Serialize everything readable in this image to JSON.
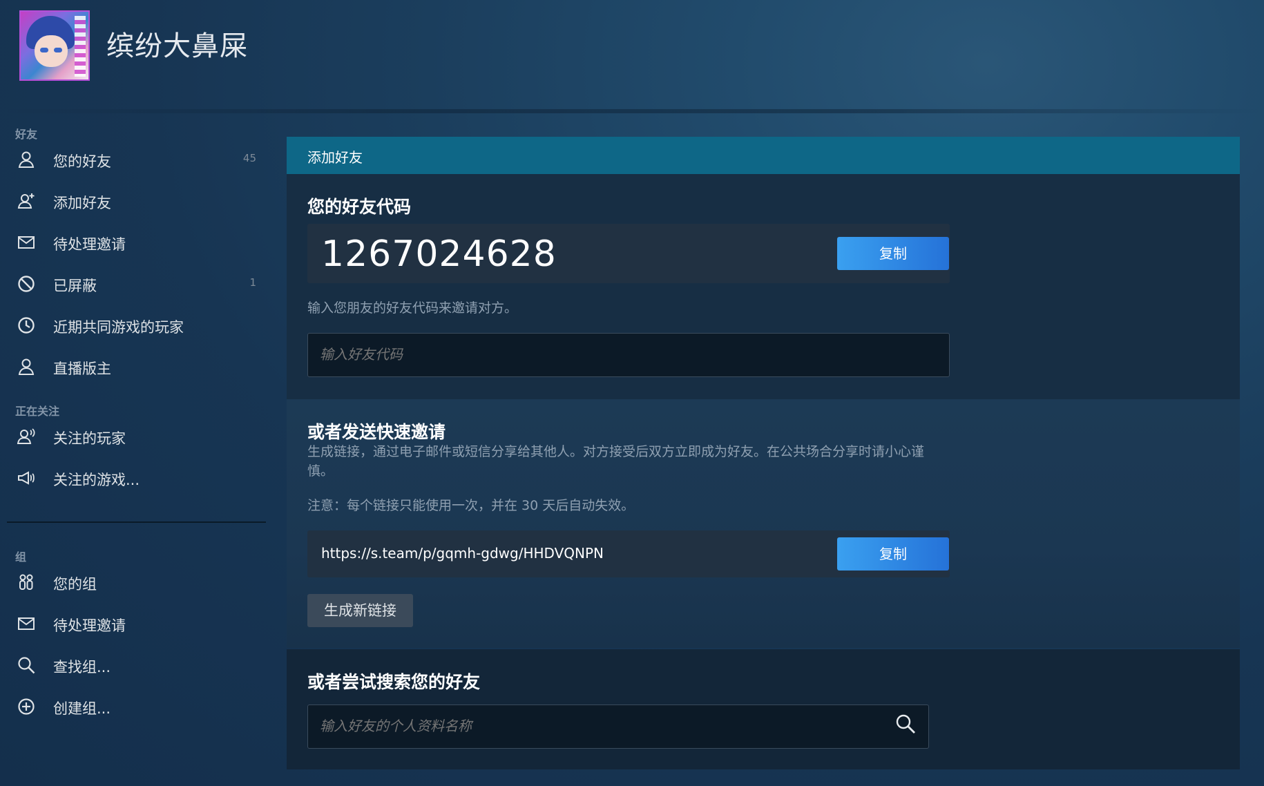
{
  "header": {
    "username": "缤纷大鼻屎",
    "avatar": "anime-avatar"
  },
  "sidebar": {
    "friends_section": "好友",
    "friends_items": [
      {
        "label": "您的好友",
        "count": "45",
        "icon": "person-icon"
      },
      {
        "label": "添加好友",
        "count": "",
        "icon": "person-add-icon"
      },
      {
        "label": "待处理邀请",
        "count": "",
        "icon": "envelope-icon"
      },
      {
        "label": "已屏蔽",
        "count": "1",
        "icon": "blocked-icon"
      },
      {
        "label": "近期共同游戏的玩家",
        "count": "",
        "icon": "clock-icon"
      },
      {
        "label": "直播版主",
        "count": "",
        "icon": "person-icon"
      }
    ],
    "following_section": "正在关注",
    "following_items": [
      {
        "label": "关注的玩家",
        "icon": "person-follow-icon"
      },
      {
        "label": "关注的游戏...",
        "icon": "megaphone-icon"
      }
    ],
    "groups_section": "组",
    "groups_items": [
      {
        "label": "您的组",
        "icon": "group-icon"
      },
      {
        "label": "待处理邀请",
        "icon": "envelope-icon"
      },
      {
        "label": "查找组...",
        "icon": "search-icon"
      },
      {
        "label": "创建组...",
        "icon": "plus-circle-icon"
      }
    ]
  },
  "main": {
    "panel_title": "添加好友",
    "friend_code_heading": "您的好友代码",
    "friend_code": "1267024628",
    "copy_label": "复制",
    "friend_code_hint": "输入您朋友的好友代码来邀请对方。",
    "friend_code_placeholder": "输入好友代码",
    "quick_invite_heading": "或者发送快速邀请",
    "quick_invite_desc": "生成链接，通过电子邮件或短信分享给其他人。对方接受后双方立即成为好友。在公共场合分享时请小心谨慎。",
    "quick_invite_note": "注意：每个链接只能使用一次，并在 30 天后自动失效。",
    "invite_link": "https://s.team/p/gqmh-gdwg/HHDVQNPN",
    "copy_label_2": "复制",
    "generate_link_label": "生成新链接",
    "search_heading": "或者尝试搜索您的好友",
    "search_placeholder": "输入好友的个人资料名称"
  },
  "colors": {
    "accent": "#0e6787",
    "button_blue": "#2f87e4"
  }
}
